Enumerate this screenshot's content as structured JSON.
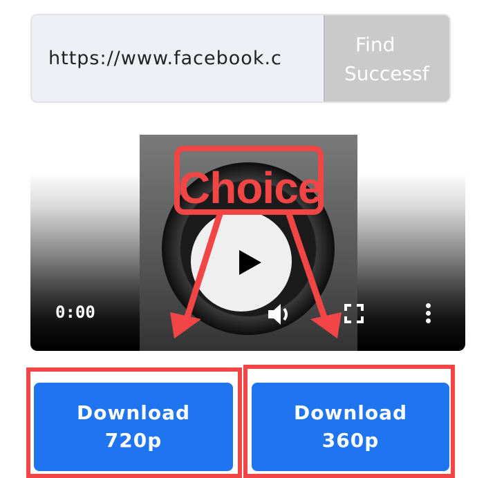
{
  "search": {
    "url_value": "https://www.facebook.c",
    "find_button_label_line1": "Find",
    "find_button_label_line2": "Successf"
  },
  "player": {
    "current_time": "0:00",
    "icons": [
      "play-icon",
      "volume-icon",
      "fullscreen-icon",
      "more-vert-icon"
    ]
  },
  "downloads": [
    {
      "line1": "Download",
      "line2": "720p"
    },
    {
      "line1": "Download",
      "line2": "360p"
    }
  ],
  "annotation": {
    "label": "Choice",
    "color": "#f24545"
  },
  "colors": {
    "button_blue": "#1f74ef",
    "find_gray": "#cacaca",
    "search_bg": "#eef0f5"
  }
}
